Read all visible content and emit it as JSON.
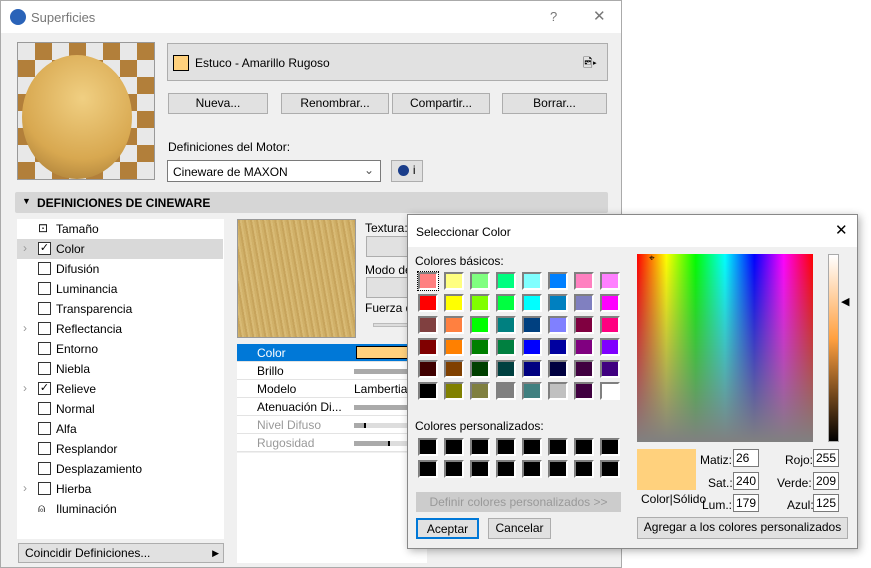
{
  "window": {
    "title": "Superficies",
    "help": "?",
    "close": "✕"
  },
  "material": {
    "name": "Estuco - Amarillo Rugoso",
    "swatch_color": "#FFD17D"
  },
  "buttons": {
    "new": "Nueva...",
    "rename": "Renombrar...",
    "share": "Compartir...",
    "delete": "Borrar..."
  },
  "engine": {
    "label": "Definiciones del Motor:",
    "value": "Cineware de MAXON",
    "info": "i"
  },
  "section": {
    "title": "DEFINICIONES DE CINEWARE"
  },
  "channels": [
    {
      "label": "Tamaño",
      "type": "icon",
      "expand": false
    },
    {
      "label": "Color",
      "type": "check",
      "checked": true,
      "expand": true
    },
    {
      "label": "Difusión",
      "type": "check",
      "checked": false,
      "expand": false
    },
    {
      "label": "Luminancia",
      "type": "check",
      "checked": false,
      "expand": false
    },
    {
      "label": "Transparencia",
      "type": "check",
      "checked": false,
      "expand": false
    },
    {
      "label": "Reflectancia",
      "type": "check",
      "checked": false,
      "expand": true
    },
    {
      "label": "Entorno",
      "type": "check",
      "checked": false,
      "expand": false
    },
    {
      "label": "Niebla",
      "type": "check",
      "checked": false,
      "expand": false
    },
    {
      "label": "Relieve",
      "type": "check",
      "checked": true,
      "expand": true
    },
    {
      "label": "Normal",
      "type": "check",
      "checked": false,
      "expand": false
    },
    {
      "label": "Alfa",
      "type": "check",
      "checked": false,
      "expand": false
    },
    {
      "label": "Resplandor",
      "type": "check",
      "checked": false,
      "expand": false
    },
    {
      "label": "Desplazamiento",
      "type": "check",
      "checked": false,
      "expand": false
    },
    {
      "label": "Hierba",
      "type": "check",
      "checked": false,
      "expand": true
    },
    {
      "label": "Iluminación",
      "type": "icon",
      "expand": false
    }
  ],
  "match_button": "Coincidir Definiciones...",
  "texture": {
    "label": "Textura:",
    "mode_label": "Modo de",
    "strength_label": "Fuerza d"
  },
  "properties": [
    {
      "label": "Color",
      "value": "",
      "selected": true
    },
    {
      "label": "Brillo",
      "value": ""
    },
    {
      "label": "Modelo",
      "value": "Lambertian"
    },
    {
      "label": "Atenuación Di...",
      "value": ""
    },
    {
      "label": "Nivel Difuso",
      "value": "",
      "disabled": true,
      "level": 0.15
    },
    {
      "label": "Rugosidad",
      "value": "",
      "disabled": true,
      "level": 0.45
    }
  ],
  "color_dialog": {
    "title": "Seleccionar Color",
    "basic_label": "Colores básicos:",
    "basic_colors": [
      "#FF8080",
      "#FFFF80",
      "#80FF80",
      "#00FF80",
      "#80FFFF",
      "#0080FF",
      "#FF80C0",
      "#FF80FF",
      "#FF0000",
      "#FFFF00",
      "#80FF00",
      "#00FF40",
      "#00FFFF",
      "#0080C0",
      "#8080C0",
      "#FF00FF",
      "#804040",
      "#FF8040",
      "#00FF00",
      "#008080",
      "#004080",
      "#8080FF",
      "#800040",
      "#FF0080",
      "#800000",
      "#FF8000",
      "#008000",
      "#008040",
      "#0000FF",
      "#0000A0",
      "#800080",
      "#8000FF",
      "#400000",
      "#804000",
      "#004000",
      "#004040",
      "#000080",
      "#000040",
      "#400040",
      "#400080",
      "#000000",
      "#808000",
      "#808040",
      "#808080",
      "#408080",
      "#C0C0C0",
      "#400040",
      "#FFFFFF"
    ],
    "custom_label": "Colores personalizados:",
    "define_button": "Definir colores personalizados >>",
    "ok": "Aceptar",
    "cancel": "Cancelar",
    "color_solid": "Color|Sólido",
    "hue_label": "Matiz:",
    "hue": "26",
    "sat_label": "Sat.:",
    "sat": "240",
    "lum_label": "Lum.:",
    "lum": "179",
    "red_label": "Rojo:",
    "red": "255",
    "green_label": "Verde:",
    "green": "209",
    "blue_label": "Azul:",
    "blue": "125",
    "add_button": "Agregar a los colores personalizados",
    "current_color": "#FFD17D"
  }
}
